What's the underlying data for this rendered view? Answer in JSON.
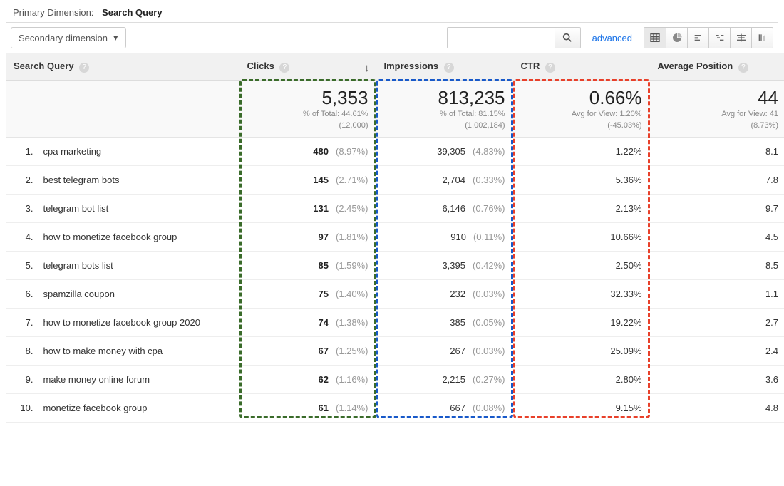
{
  "primary_dimension": {
    "label": "Primary Dimension:",
    "value": "Search Query"
  },
  "secondary_dimension": {
    "label": "Secondary dimension"
  },
  "search": {
    "placeholder": ""
  },
  "advanced_label": "advanced",
  "columns": {
    "query": "Search Query",
    "clicks": "Clicks",
    "impr": "Impressions",
    "ctr": "CTR",
    "pos": "Average Position"
  },
  "summary": {
    "clicks": {
      "big": "5,353",
      "sub1": "% of Total: 44.61%",
      "sub2": "(12,000)"
    },
    "impr": {
      "big": "813,235",
      "sub1": "% of Total: 81.15%",
      "sub2": "(1,002,184)"
    },
    "ctr": {
      "big": "0.66%",
      "sub1": "Avg for View: 1.20%",
      "sub2": "(-45.03%)"
    },
    "pos": {
      "big": "44",
      "sub1": "Avg for View: 41",
      "sub2": "(8.73%)"
    }
  },
  "rows": [
    {
      "n": "1.",
      "query": "cpa marketing",
      "clicks": "480",
      "clicks_pct": "(8.97%)",
      "impr": "39,305",
      "impr_pct": "(4.83%)",
      "ctr": "1.22%",
      "pos": "8.1"
    },
    {
      "n": "2.",
      "query": "best telegram bots",
      "clicks": "145",
      "clicks_pct": "(2.71%)",
      "impr": "2,704",
      "impr_pct": "(0.33%)",
      "ctr": "5.36%",
      "pos": "7.8"
    },
    {
      "n": "3.",
      "query": "telegram bot list",
      "clicks": "131",
      "clicks_pct": "(2.45%)",
      "impr": "6,146",
      "impr_pct": "(0.76%)",
      "ctr": "2.13%",
      "pos": "9.7"
    },
    {
      "n": "4.",
      "query": "how to monetize facebook group",
      "clicks": "97",
      "clicks_pct": "(1.81%)",
      "impr": "910",
      "impr_pct": "(0.11%)",
      "ctr": "10.66%",
      "pos": "4.5"
    },
    {
      "n": "5.",
      "query": "telegram bots list",
      "clicks": "85",
      "clicks_pct": "(1.59%)",
      "impr": "3,395",
      "impr_pct": "(0.42%)",
      "ctr": "2.50%",
      "pos": "8.5"
    },
    {
      "n": "6.",
      "query": "spamzilla coupon",
      "clicks": "75",
      "clicks_pct": "(1.40%)",
      "impr": "232",
      "impr_pct": "(0.03%)",
      "ctr": "32.33%",
      "pos": "1.1"
    },
    {
      "n": "7.",
      "query": "how to monetize facebook group 2020",
      "clicks": "74",
      "clicks_pct": "(1.38%)",
      "impr": "385",
      "impr_pct": "(0.05%)",
      "ctr": "19.22%",
      "pos": "2.7"
    },
    {
      "n": "8.",
      "query": "how to make money with cpa",
      "clicks": "67",
      "clicks_pct": "(1.25%)",
      "impr": "267",
      "impr_pct": "(0.03%)",
      "ctr": "25.09%",
      "pos": "2.4"
    },
    {
      "n": "9.",
      "query": "make money online forum",
      "clicks": "62",
      "clicks_pct": "(1.16%)",
      "impr": "2,215",
      "impr_pct": "(0.27%)",
      "ctr": "2.80%",
      "pos": "3.6"
    },
    {
      "n": "10.",
      "query": "monetize facebook group",
      "clicks": "61",
      "clicks_pct": "(1.14%)",
      "impr": "667",
      "impr_pct": "(0.08%)",
      "ctr": "9.15%",
      "pos": "4.8"
    }
  ]
}
